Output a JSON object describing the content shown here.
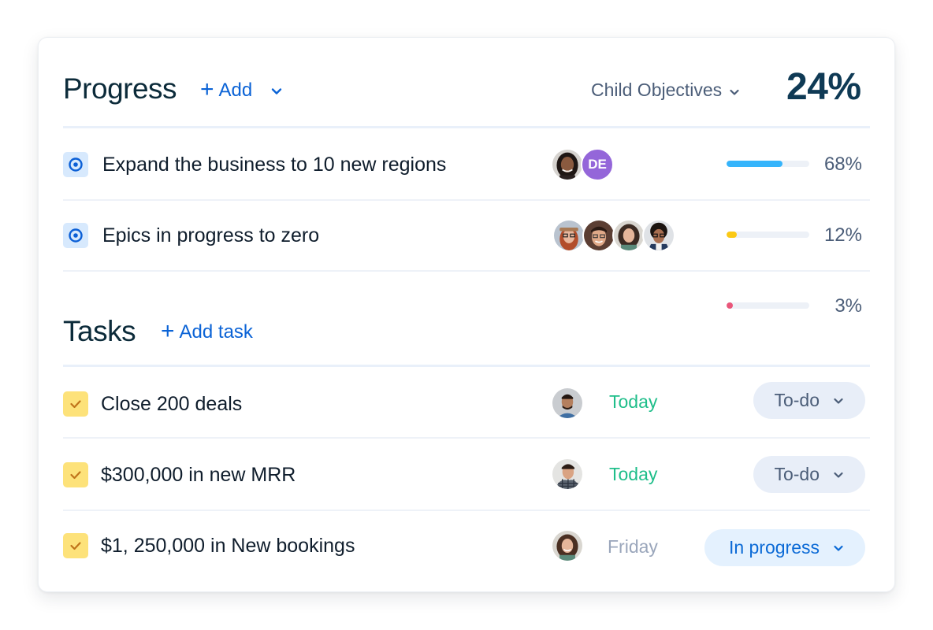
{
  "progress": {
    "title": "Progress",
    "add_label": "Add",
    "add_icon": "plus-icon",
    "dropdown_icon": "chevron-down-icon",
    "view_selector": "Child Objectives",
    "overall_percent": "24%",
    "objectives": [
      {
        "icon": "target-icon",
        "title": "Expand the business to 10 new regions",
        "assignees": [
          {
            "type": "photo",
            "name": "woman-dark-hair"
          },
          {
            "type": "initials",
            "initials": "DE",
            "color": "#9466d9"
          }
        ],
        "progress": 68,
        "progress_label": "68%",
        "bar_color": "#35b4fb"
      },
      {
        "icon": "target-icon",
        "title": "Epics in progress to zero",
        "assignees": [
          {
            "type": "photo",
            "name": "woman-hat-glasses"
          },
          {
            "type": "photo",
            "name": "man-glasses"
          },
          {
            "type": "photo",
            "name": "woman-curly-hair"
          },
          {
            "type": "photo",
            "name": "man-curly-glasses"
          }
        ],
        "progress": 12,
        "progress_label": "12%",
        "bar_color": "#fbc915"
      },
      {
        "icon": "",
        "title": "",
        "assignees": [],
        "progress": 3,
        "progress_label": "3%",
        "bar_color": "#e9567a"
      }
    ]
  },
  "tasks": {
    "title": "Tasks",
    "add_label": "Add task",
    "add_icon": "plus-icon",
    "items": [
      {
        "title": "Close 200 deals",
        "assignee": "man-beard",
        "due": "Today",
        "due_color": "#1fbe8a",
        "status": "To-do",
        "status_style": "todo"
      },
      {
        "title": "$300,000 in new MRR",
        "assignee": "man-plaid-shirt",
        "due": "Today",
        "due_color": "#1fbe8a",
        "status": "To-do",
        "status_style": "todo"
      },
      {
        "title": "$1, 250,000 in New bookings",
        "assignee": "woman-curly-hair",
        "due": "Friday",
        "due_color": "#9aa6bb",
        "status": "In progress",
        "status_style": "inprog"
      }
    ]
  }
}
